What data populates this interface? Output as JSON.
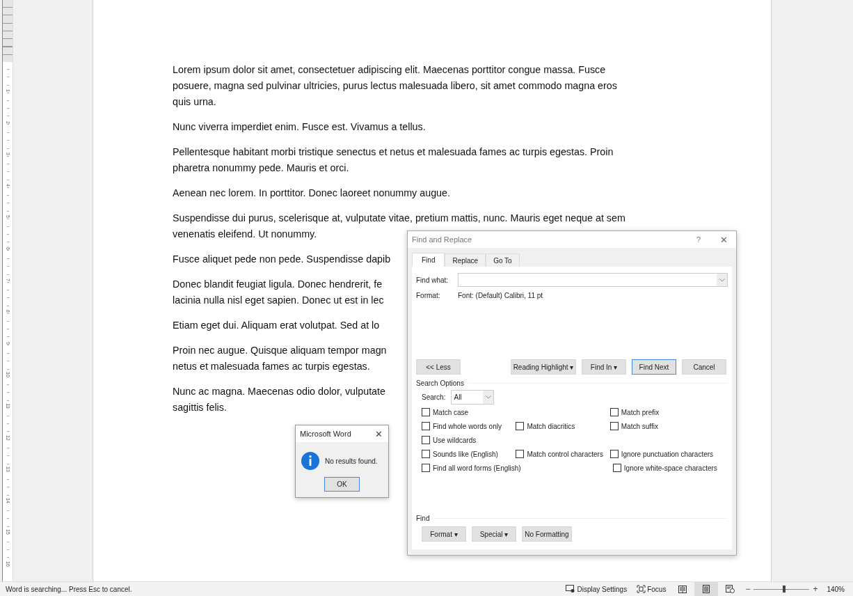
{
  "document": {
    "paragraphs": [
      {
        "lines": [
          "Lorem ipsum dolor sit amet, consectetuer adipiscing elit. Maecenas porttitor congue massa. Fusce",
          "posuere, magna sed pulvinar ultricies, purus lectus malesuada libero, sit amet commodo magna eros",
          "quis urna."
        ]
      },
      {
        "lines": [
          "Nunc viverra imperdiet enim. Fusce est. Vivamus a tellus."
        ]
      },
      {
        "lines": [
          "Pellentesque habitant morbi tristique senectus et netus et malesuada fames ac turpis egestas. Proin",
          "pharetra nonummy pede. Mauris et orci."
        ]
      },
      {
        "lines": [
          "Aenean nec lorem. In porttitor. Donec laoreet nonummy augue."
        ]
      },
      {
        "lines": [
          "Suspendisse dui purus, scelerisque at, vulputate vitae, pretium mattis, nunc. Mauris eget neque at sem",
          "venenatis eleifend. Ut nonummy."
        ]
      },
      {
        "lines": [
          "Fusce aliquet pede non pede. Suspendisse dapib"
        ]
      },
      {
        "lines": [
          "Donec blandit feugiat ligula. Donec hendrerit, fe",
          "lacinia nulla nisl eget sapien. Donec ut est in lec"
        ]
      },
      {
        "lines": [
          "Etiam eget dui. Aliquam erat volutpat. Sed at lo"
        ]
      },
      {
        "lines": [
          "Proin nec augue. Quisque aliquam tempor magn",
          "netus et malesuada fames ac turpis egestas."
        ]
      },
      {
        "lines": [
          "Nunc ac magna. Maecenas odio dolor, vulputate",
          "sagittis felis."
        ]
      }
    ]
  },
  "ruler": {
    "labels": [
      "1",
      "2",
      "3",
      "4",
      "5",
      "6",
      "7",
      "8",
      "9",
      "10",
      "11",
      "12",
      "13",
      "14",
      "15",
      "16"
    ]
  },
  "find_dialog": {
    "title": "Find and Replace",
    "help": "?",
    "close": "✕",
    "tabs": [
      {
        "label": "Find",
        "selected": true
      },
      {
        "label": "Replace",
        "selected": false
      },
      {
        "label": "Go To",
        "selected": false
      }
    ],
    "find_what": {
      "label": "Find what:"
    },
    "format": {
      "label": "Format:",
      "value": "Font: (Default) Calibri, 11 pt"
    },
    "buttons": [
      {
        "label": "<< Less",
        "kind": "plain"
      },
      {
        "label": "Reading Highlight ▾",
        "kind": "plain"
      },
      {
        "label": "Find In ▾",
        "kind": "plain"
      },
      {
        "label": "Find Next",
        "kind": "default"
      },
      {
        "label": "Cancel",
        "kind": "plain"
      }
    ],
    "search_options": {
      "heading": "Search Options",
      "search_label": "Search:",
      "search_value": "All",
      "rows": [
        {
          "left": {
            "label": "Match case",
            "checked": false
          },
          "right": {
            "label": "Match prefix",
            "checked": false
          }
        },
        {
          "left": {
            "label": "Find whole words only",
            "checked": false
          },
          "middle": {
            "label": "Match diacritics",
            "checked": false
          },
          "right": {
            "label": "Match suffix",
            "checked": false
          }
        },
        {
          "left": {
            "label": "Use wildcards",
            "checked": false
          }
        },
        {
          "left": {
            "label": "Sounds like (English)",
            "checked": false
          },
          "middle": {
            "label": "Match control characters",
            "checked": false
          },
          "right": {
            "label": "Ignore punctuation characters",
            "checked": false
          }
        },
        {
          "left": {
            "label": "Find all word forms (English)",
            "checked": false
          },
          "right": {
            "label": "Ignore white-space characters",
            "checked": false
          }
        }
      ]
    },
    "find_section": {
      "heading": "Find",
      "buttons": [
        "Format ▾",
        "Special ▾",
        "No Formatting"
      ]
    }
  },
  "message_box": {
    "title": "Microsoft Word",
    "close": "✕",
    "message": "No results found.",
    "button": "OK"
  },
  "status_bar": {
    "text": "Word is searching... Press Esc to cancel.",
    "display_settings": "Display Settings",
    "focus": "Focus",
    "views": [
      {
        "kind": "read",
        "selected": false
      },
      {
        "kind": "print",
        "selected": true
      },
      {
        "kind": "web",
        "selected": false
      }
    ],
    "zoom_minus": "−",
    "zoom_plus": "+",
    "zoom": {
      "level": 0.54
    },
    "zoom_text": "140%"
  }
}
